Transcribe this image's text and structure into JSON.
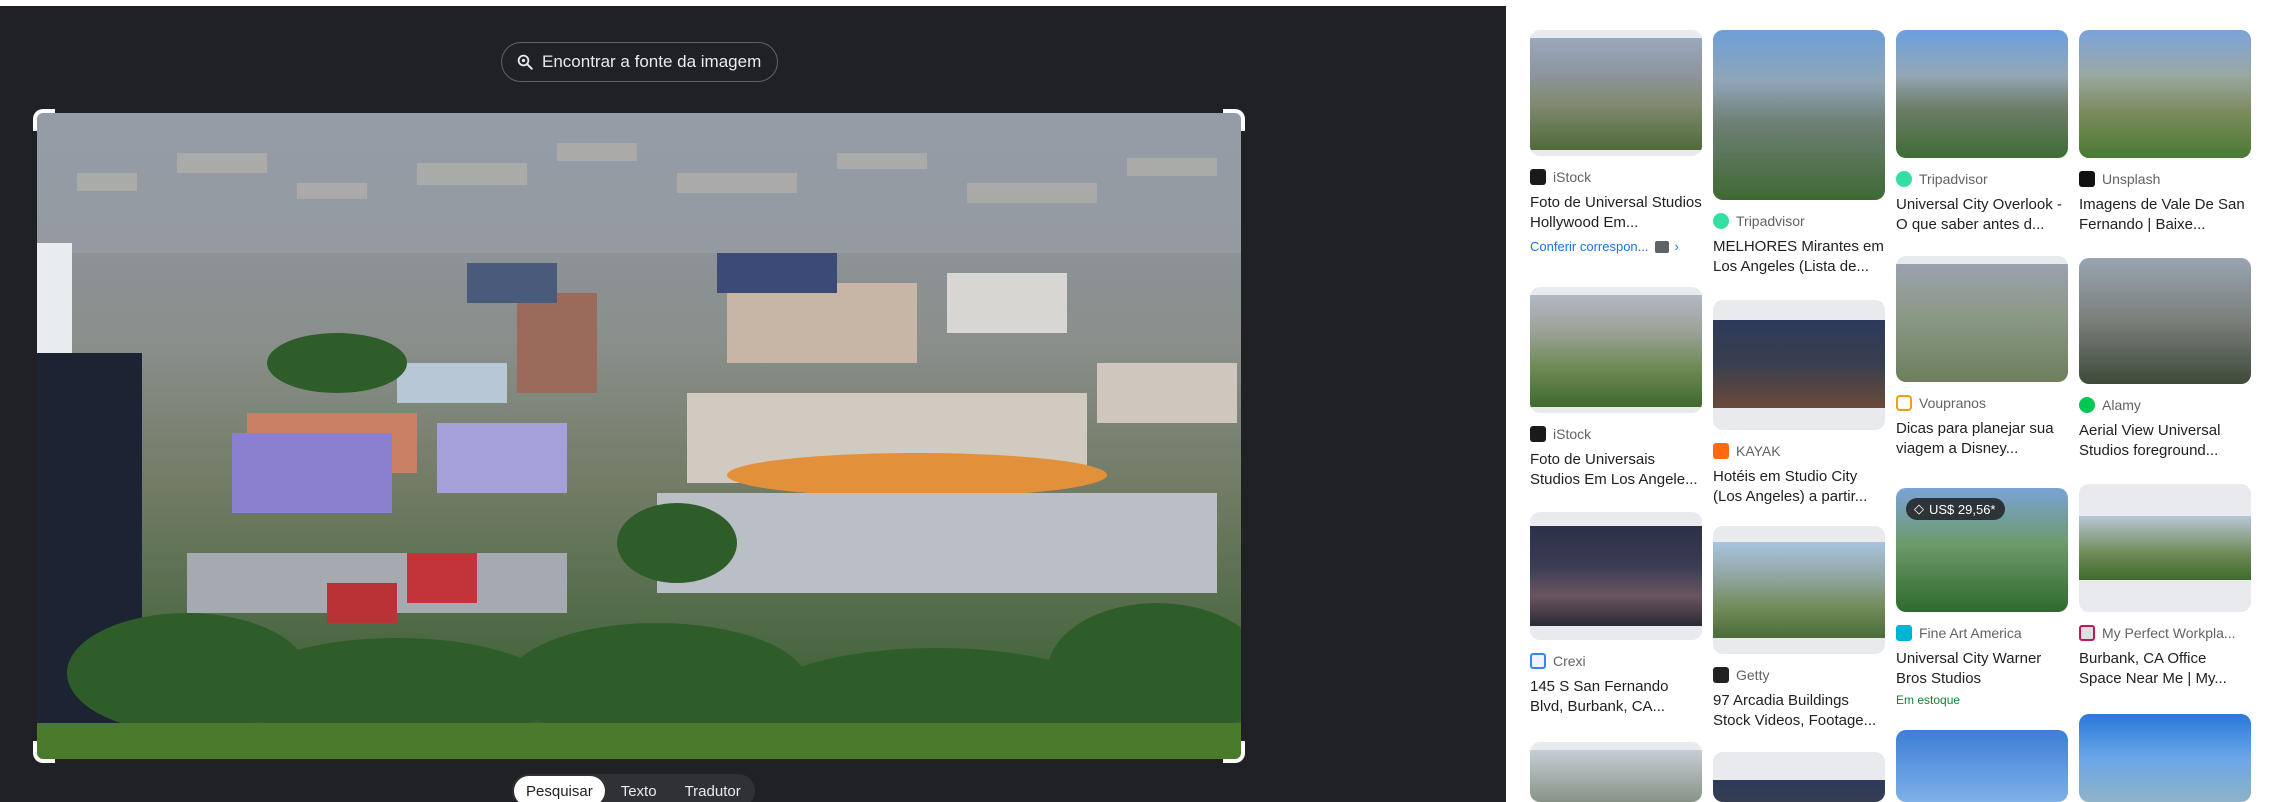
{
  "viewer": {
    "find_source_label": "Encontrar a fonte da imagem",
    "modes": [
      "Pesquisar",
      "Texto",
      "Tradutor"
    ],
    "active_mode": "Pesquisar"
  },
  "results": {
    "col1": [
      {
        "source": "iStock",
        "title": "Foto de Universal Studios Hollywood Em...",
        "extra": "Conferir correspon..."
      },
      {
        "source": "iStock",
        "title": "Foto de Universais Studios Em Los Angele..."
      },
      {
        "source": "Crexi",
        "title": "145 S San Fernando Blvd, Burbank, CA..."
      }
    ],
    "col2": [
      {
        "source": "Tripadvisor",
        "title": "MELHORES Mirantes em Los Angeles (Lista de..."
      },
      {
        "source": "KAYAK",
        "title": "Hotéis em Studio City (Los Angeles) a partir..."
      },
      {
        "source": "Getty",
        "title": "97 Arcadia Buildings Stock Videos, Footage..."
      }
    ],
    "col3": [
      {
        "source": "Tripadvisor",
        "title": "Universal City Overlook - O que saber antes d..."
      },
      {
        "source": "Voupranos",
        "title": "Dicas para planejar sua viagem a Disney..."
      },
      {
        "source": "Fine Art America",
        "title": "Universal City Warner Bros Studios",
        "price": "US$ 29,56*",
        "stock": "Em estoque"
      }
    ],
    "col4": [
      {
        "source": "Unsplash",
        "title": "Imagens de Vale De San Fernando | Baixe..."
      },
      {
        "source": "Alamy",
        "title": "Aerial View Universal Studios foreground..."
      },
      {
        "source": "My Perfect Workpla...",
        "title": "Burbank, CA Office Space Near Me | My..."
      }
    ]
  }
}
